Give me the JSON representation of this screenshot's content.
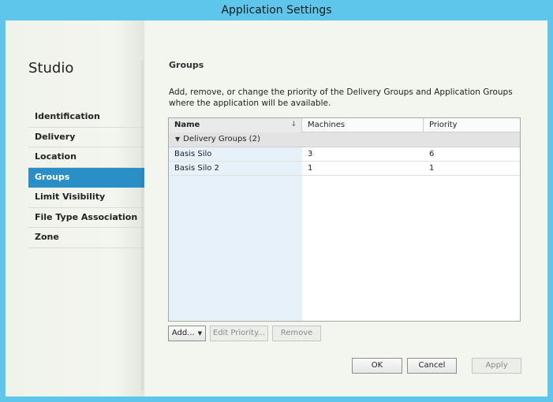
{
  "window": {
    "title": "Application Settings"
  },
  "sidebar": {
    "title": "Studio",
    "items": [
      {
        "label": "Identification"
      },
      {
        "label": "Delivery"
      },
      {
        "label": "Location"
      },
      {
        "label": "Groups"
      },
      {
        "label": "Limit Visibility"
      },
      {
        "label": "File Type Association"
      },
      {
        "label": "Zone"
      }
    ],
    "active_index": 3
  },
  "main": {
    "section_title": "Groups",
    "description": "Add, remove, or change the priority of the Delivery Groups and Application Groups where the application will be available.",
    "table": {
      "columns": [
        "Name",
        "Machines",
        "Priority"
      ],
      "group_label": "Delivery Groups (2)",
      "rows": [
        {
          "name": "Basis Silo",
          "machines": "3",
          "priority": "6"
        },
        {
          "name": "Basis Silo 2",
          "machines": "1",
          "priority": "1"
        }
      ]
    },
    "actions": {
      "add": "Add...",
      "edit_priority": "Edit Priority...",
      "remove": "Remove"
    }
  },
  "footer": {
    "ok": "OK",
    "cancel": "Cancel",
    "apply": "Apply"
  },
  "icons": {
    "sort": "sort-down-arrow-icon",
    "group_toggle": "triangle-down-icon",
    "add_menu": "caret-down-icon"
  },
  "colors": {
    "accent": "#2a8fc6",
    "titlebar": "#5ec6ea"
  }
}
